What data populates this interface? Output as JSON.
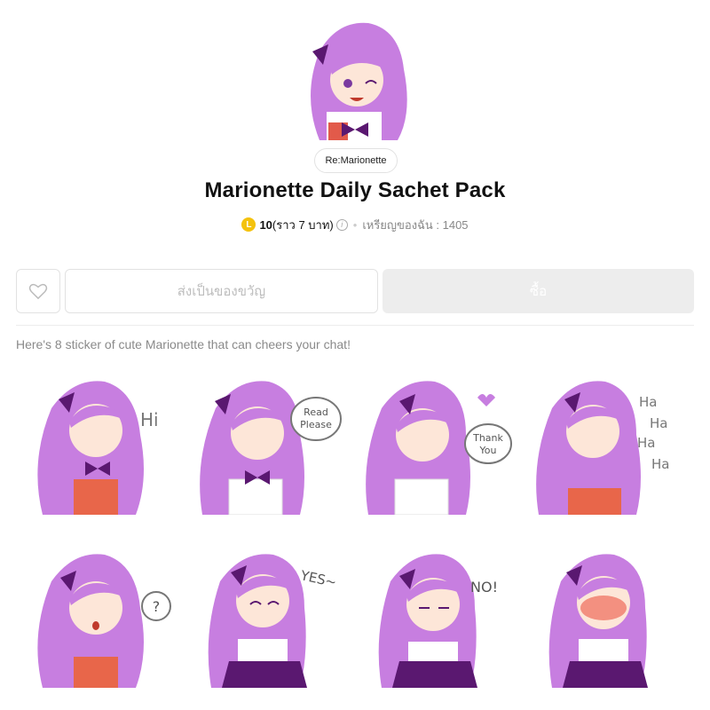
{
  "header": {
    "author": "Re:Marionette",
    "title": "Marionette Daily Sachet Pack",
    "coin_letter": "L",
    "price": "10",
    "price_approx": "(ราว 7 บาท)",
    "info_glyph": "i",
    "separator": "•",
    "balance": "เหรียญของฉัน : 1405"
  },
  "actions": {
    "gift_label": "ส่งเป็นของขวัญ",
    "buy_label": "ซื้อ"
  },
  "description": "Here's 8 sticker of cute Marionette that can cheers your chat!",
  "colors": {
    "hair": "#c77ee0",
    "hair_shadow": "#9a4fc4",
    "bow": "#5a1870",
    "skin": "#fde6d8",
    "coin": "#f4c20d"
  },
  "stickers": [
    {
      "name": "hi",
      "text": "Hi",
      "bubble": false
    },
    {
      "name": "read-please",
      "text": "Read\nPlease",
      "bubble": true
    },
    {
      "name": "thank-you",
      "text": "Thank\nYou",
      "bubble": true
    },
    {
      "name": "ha-ha",
      "text": "Ha\nHa\nHa\nHa",
      "bubble": false
    },
    {
      "name": "question",
      "text": "?",
      "bubble": true
    },
    {
      "name": "yes",
      "text": "YES~",
      "bubble": false
    },
    {
      "name": "no",
      "text": "NO!",
      "bubble": false
    },
    {
      "name": "blush",
      "text": "",
      "bubble": false
    }
  ]
}
